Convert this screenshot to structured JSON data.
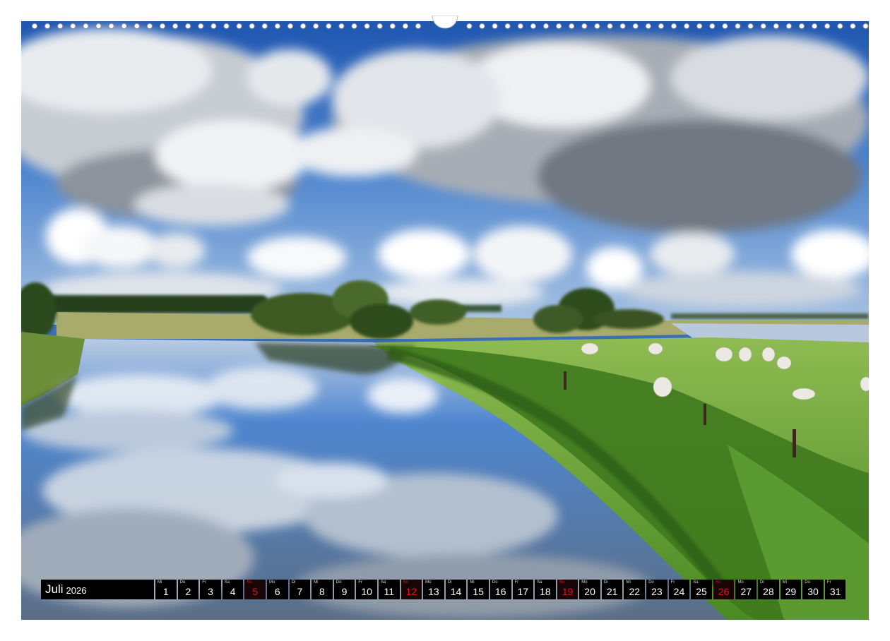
{
  "calendar": {
    "month": "Juli",
    "year": "2026",
    "days": [
      {
        "wd": "Mi",
        "d": "1",
        "sun": false
      },
      {
        "wd": "Do",
        "d": "2",
        "sun": false
      },
      {
        "wd": "Fr",
        "d": "3",
        "sun": false
      },
      {
        "wd": "Sa",
        "d": "4",
        "sun": false
      },
      {
        "wd": "So",
        "d": "5",
        "sun": true
      },
      {
        "wd": "Mo",
        "d": "6",
        "sun": false
      },
      {
        "wd": "Di",
        "d": "7",
        "sun": false
      },
      {
        "wd": "Mi",
        "d": "8",
        "sun": false
      },
      {
        "wd": "Do",
        "d": "9",
        "sun": false
      },
      {
        "wd": "Fr",
        "d": "10",
        "sun": false
      },
      {
        "wd": "Sa",
        "d": "11",
        "sun": false
      },
      {
        "wd": "So",
        "d": "12",
        "sun": true
      },
      {
        "wd": "Mo",
        "d": "13",
        "sun": false
      },
      {
        "wd": "Di",
        "d": "14",
        "sun": false
      },
      {
        "wd": "Mi",
        "d": "15",
        "sun": false
      },
      {
        "wd": "Do",
        "d": "16",
        "sun": false
      },
      {
        "wd": "Fr",
        "d": "17",
        "sun": false
      },
      {
        "wd": "Sa",
        "d": "18",
        "sun": false
      },
      {
        "wd": "So",
        "d": "19",
        "sun": true
      },
      {
        "wd": "Mo",
        "d": "20",
        "sun": false
      },
      {
        "wd": "Di",
        "d": "21",
        "sun": false
      },
      {
        "wd": "Mi",
        "d": "22",
        "sun": false
      },
      {
        "wd": "Do",
        "d": "23",
        "sun": false
      },
      {
        "wd": "Fr",
        "d": "24",
        "sun": false
      },
      {
        "wd": "Sa",
        "d": "25",
        "sun": false
      },
      {
        "wd": "So",
        "d": "26",
        "sun": true
      },
      {
        "wd": "Mo",
        "d": "27",
        "sun": false
      },
      {
        "wd": "Di",
        "d": "28",
        "sun": false
      },
      {
        "wd": "Mi",
        "d": "29",
        "sun": false
      },
      {
        "wd": "Do",
        "d": "30",
        "sun": false
      },
      {
        "wd": "Fr",
        "d": "31",
        "sun": false
      }
    ]
  },
  "colors": {
    "sunday": "#e1141e",
    "strip": "#000000",
    "sky": "#3b6fb8",
    "grass": "#5e9a2c"
  }
}
